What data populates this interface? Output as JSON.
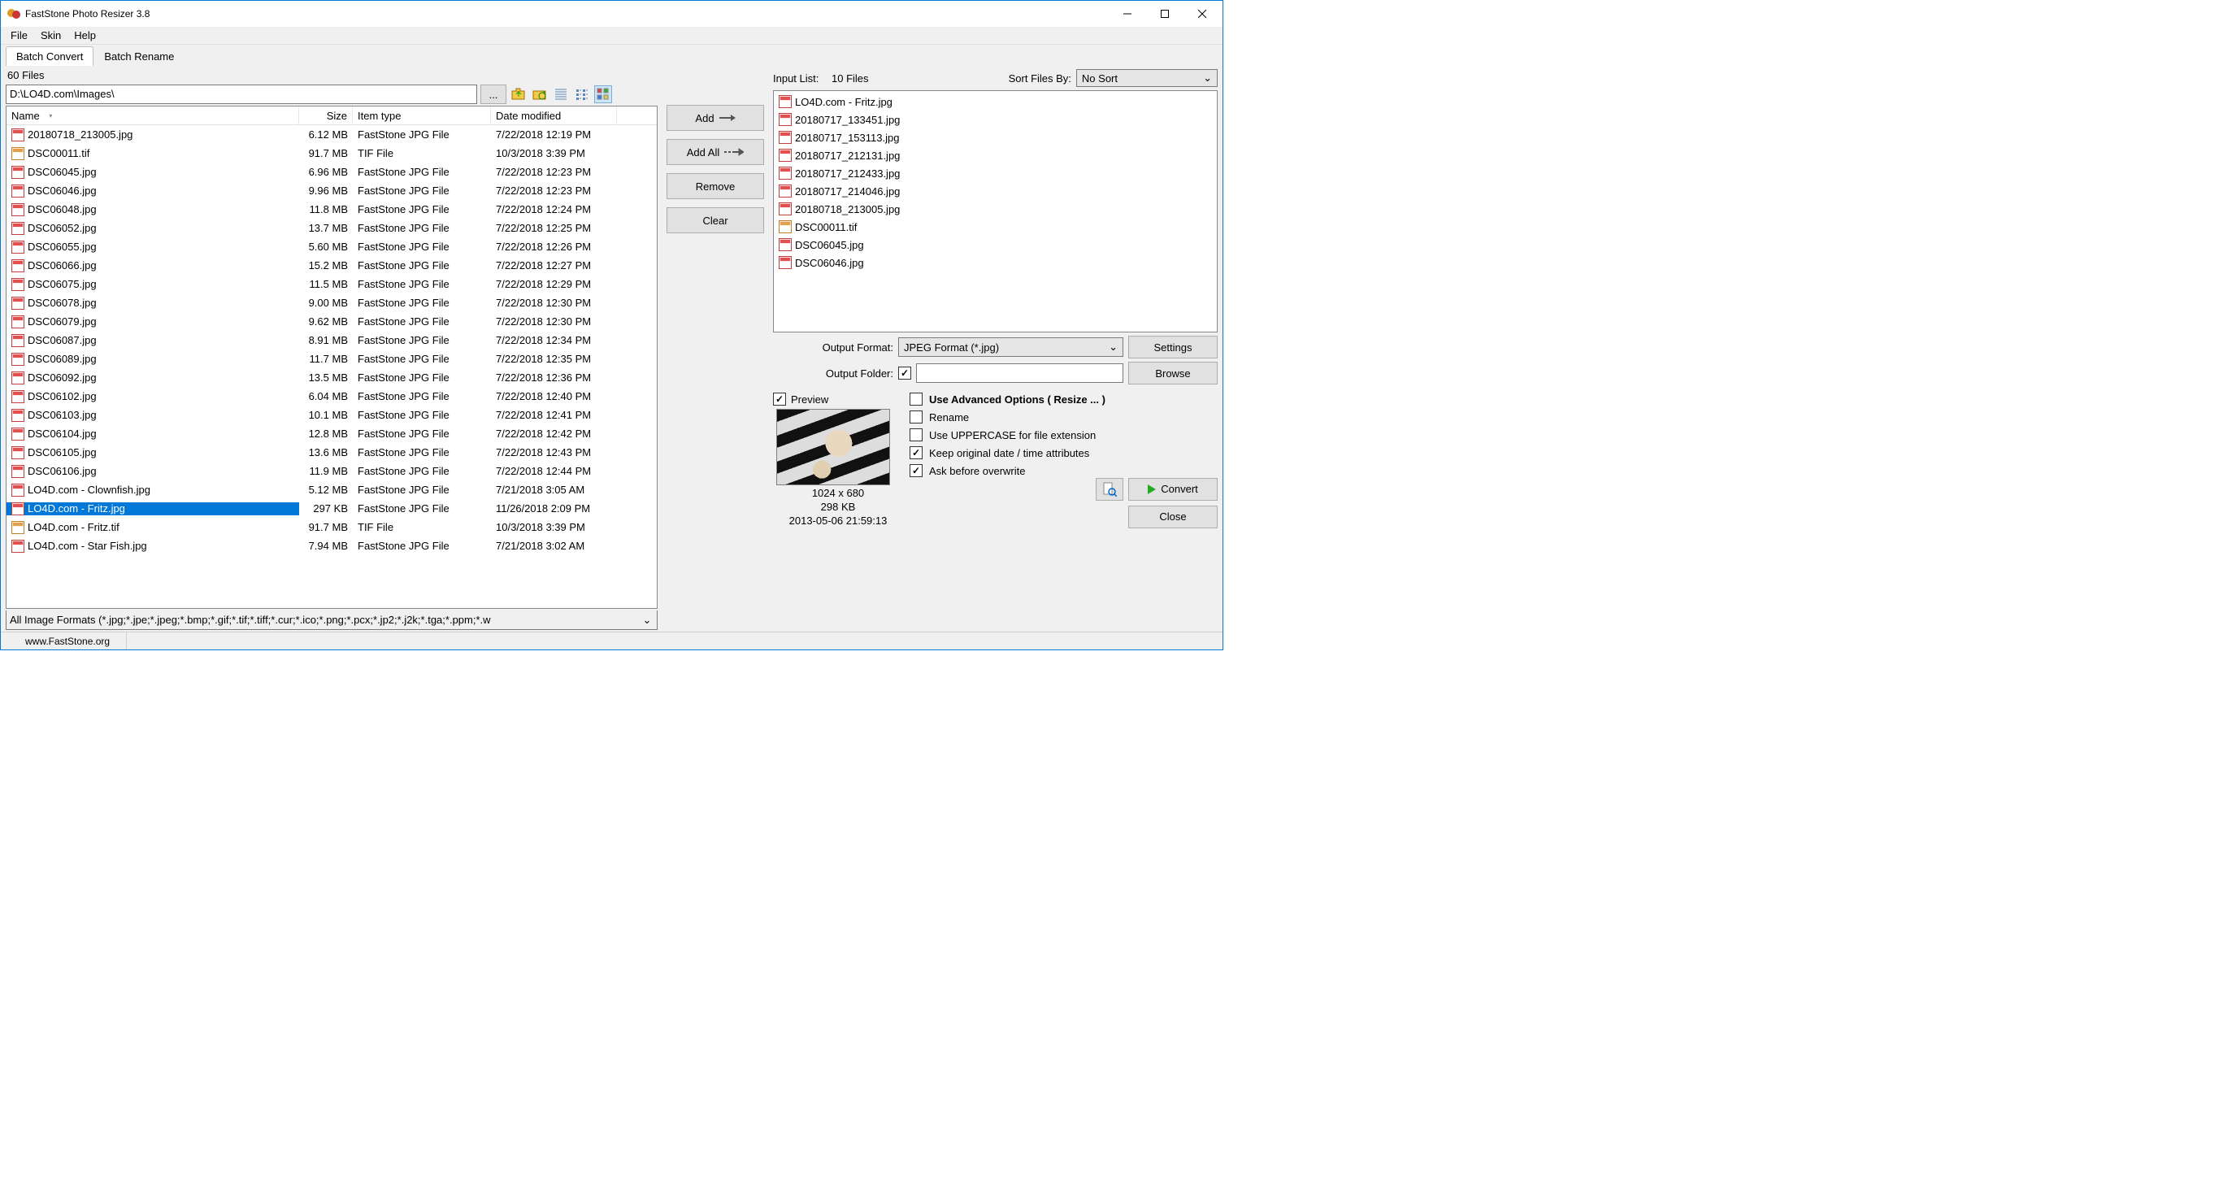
{
  "window": {
    "title": "FastStone Photo Resizer 3.8"
  },
  "menu": {
    "file": "File",
    "skin": "Skin",
    "help": "Help"
  },
  "tabs": {
    "convert": "Batch Convert",
    "rename": "Batch Rename"
  },
  "browser": {
    "file_count": "60 Files",
    "path": "D:\\LO4D.com\\Images\\",
    "browse_btn": "...",
    "columns": {
      "name": "Name",
      "size": "Size",
      "type": "Item type",
      "date": "Date modified"
    },
    "filter": "All Image Formats (*.jpg;*.jpe;*.jpeg;*.bmp;*.gif;*.tif;*.tiff;*.cur;*.ico;*.png;*.pcx;*.jp2;*.j2k;*.tga;*.ppm;*.w",
    "files": [
      {
        "name": "20180718_213005.jpg",
        "size": "6.12 MB",
        "type": "FastStone JPG File",
        "date": "7/22/2018 12:19 PM",
        "ext": "jpg"
      },
      {
        "name": "DSC00011.tif",
        "size": "91.7 MB",
        "type": "TIF File",
        "date": "10/3/2018 3:39 PM",
        "ext": "tif"
      },
      {
        "name": "DSC06045.jpg",
        "size": "6.96 MB",
        "type": "FastStone JPG File",
        "date": "7/22/2018 12:23 PM",
        "ext": "jpg"
      },
      {
        "name": "DSC06046.jpg",
        "size": "9.96 MB",
        "type": "FastStone JPG File",
        "date": "7/22/2018 12:23 PM",
        "ext": "jpg"
      },
      {
        "name": "DSC06048.jpg",
        "size": "11.8 MB",
        "type": "FastStone JPG File",
        "date": "7/22/2018 12:24 PM",
        "ext": "jpg"
      },
      {
        "name": "DSC06052.jpg",
        "size": "13.7 MB",
        "type": "FastStone JPG File",
        "date": "7/22/2018 12:25 PM",
        "ext": "jpg"
      },
      {
        "name": "DSC06055.jpg",
        "size": "5.60 MB",
        "type": "FastStone JPG File",
        "date": "7/22/2018 12:26 PM",
        "ext": "jpg"
      },
      {
        "name": "DSC06066.jpg",
        "size": "15.2 MB",
        "type": "FastStone JPG File",
        "date": "7/22/2018 12:27 PM",
        "ext": "jpg"
      },
      {
        "name": "DSC06075.jpg",
        "size": "11.5 MB",
        "type": "FastStone JPG File",
        "date": "7/22/2018 12:29 PM",
        "ext": "jpg"
      },
      {
        "name": "DSC06078.jpg",
        "size": "9.00 MB",
        "type": "FastStone JPG File",
        "date": "7/22/2018 12:30 PM",
        "ext": "jpg"
      },
      {
        "name": "DSC06079.jpg",
        "size": "9.62 MB",
        "type": "FastStone JPG File",
        "date": "7/22/2018 12:30 PM",
        "ext": "jpg"
      },
      {
        "name": "DSC06087.jpg",
        "size": "8.91 MB",
        "type": "FastStone JPG File",
        "date": "7/22/2018 12:34 PM",
        "ext": "jpg"
      },
      {
        "name": "DSC06089.jpg",
        "size": "11.7 MB",
        "type": "FastStone JPG File",
        "date": "7/22/2018 12:35 PM",
        "ext": "jpg"
      },
      {
        "name": "DSC06092.jpg",
        "size": "13.5 MB",
        "type": "FastStone JPG File",
        "date": "7/22/2018 12:36 PM",
        "ext": "jpg"
      },
      {
        "name": "DSC06102.jpg",
        "size": "6.04 MB",
        "type": "FastStone JPG File",
        "date": "7/22/2018 12:40 PM",
        "ext": "jpg"
      },
      {
        "name": "DSC06103.jpg",
        "size": "10.1 MB",
        "type": "FastStone JPG File",
        "date": "7/22/2018 12:41 PM",
        "ext": "jpg"
      },
      {
        "name": "DSC06104.jpg",
        "size": "12.8 MB",
        "type": "FastStone JPG File",
        "date": "7/22/2018 12:42 PM",
        "ext": "jpg"
      },
      {
        "name": "DSC06105.jpg",
        "size": "13.6 MB",
        "type": "FastStone JPG File",
        "date": "7/22/2018 12:43 PM",
        "ext": "jpg"
      },
      {
        "name": "DSC06106.jpg",
        "size": "11.9 MB",
        "type": "FastStone JPG File",
        "date": "7/22/2018 12:44 PM",
        "ext": "jpg"
      },
      {
        "name": "LO4D.com - Clownfish.jpg",
        "size": "5.12 MB",
        "type": "FastStone JPG File",
        "date": "7/21/2018 3:05 AM",
        "ext": "jpg"
      },
      {
        "name": "LO4D.com - Fritz.jpg",
        "size": "297 KB",
        "type": "FastStone JPG File",
        "date": "11/26/2018 2:09 PM",
        "ext": "jpg",
        "selected": true
      },
      {
        "name": "LO4D.com - Fritz.tif",
        "size": "91.7 MB",
        "type": "TIF File",
        "date": "10/3/2018 3:39 PM",
        "ext": "tif"
      },
      {
        "name": "LO4D.com - Star Fish.jpg",
        "size": "7.94 MB",
        "type": "FastStone JPG File",
        "date": "7/21/2018 3:02 AM",
        "ext": "jpg"
      }
    ]
  },
  "actions": {
    "add": "Add",
    "add_all": "Add All",
    "remove": "Remove",
    "clear": "Clear"
  },
  "input_list": {
    "label": "Input List:",
    "count": "10 Files",
    "sort_label": "Sort Files By:",
    "sort_value": "No Sort",
    "items": [
      {
        "name": "LO4D.com - Fritz.jpg",
        "ext": "jpg"
      },
      {
        "name": "20180717_133451.jpg",
        "ext": "jpg"
      },
      {
        "name": "20180717_153113.jpg",
        "ext": "jpg"
      },
      {
        "name": "20180717_212131.jpg",
        "ext": "jpg"
      },
      {
        "name": "20180717_212433.jpg",
        "ext": "jpg"
      },
      {
        "name": "20180717_214046.jpg",
        "ext": "jpg"
      },
      {
        "name": "20180718_213005.jpg",
        "ext": "jpg"
      },
      {
        "name": "DSC00011.tif",
        "ext": "tif"
      },
      {
        "name": "DSC06045.jpg",
        "ext": "jpg"
      },
      {
        "name": "DSC06046.jpg",
        "ext": "jpg"
      }
    ]
  },
  "output": {
    "format_label": "Output Format:",
    "format_value": "JPEG Format (*.jpg)",
    "settings_btn": "Settings",
    "folder_label": "Output Folder:",
    "folder_value": "",
    "browse_btn": "Browse"
  },
  "options": {
    "preview_label": "Preview",
    "advanced_label": "Use Advanced Options ( Resize ... )",
    "rename_label": "Rename",
    "uppercase_label": "Use UPPERCASE for file extension",
    "keepdate_label": "Keep original date / time attributes",
    "askoverwrite_label": "Ask before overwrite"
  },
  "preview": {
    "dims": "1024 x 680",
    "size": "298 KB",
    "date": "2013-05-06 21:59:13"
  },
  "buttons": {
    "convert": "Convert",
    "close": "Close"
  },
  "status": {
    "url": "www.FastStone.org"
  }
}
